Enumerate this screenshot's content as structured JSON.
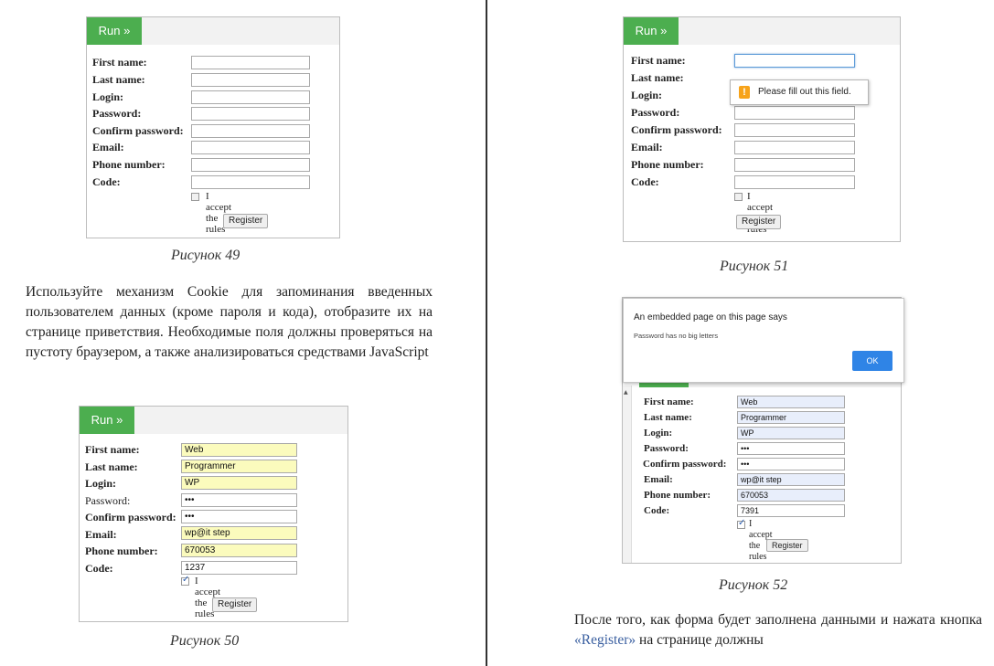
{
  "forms": {
    "run_label": "Run »",
    "labels": [
      "First name:",
      "Last name:",
      "Login:",
      "Password:",
      "Confirm password:",
      "Email:",
      "Phone number:",
      "Code:"
    ],
    "accept_label": "I accept the rules",
    "register_label": "Register",
    "fig50_values": [
      "Web",
      "Programmer",
      "WP",
      "•••",
      "•••",
      "wp@it step",
      "670053",
      "1237"
    ],
    "fig52_values": [
      "Web",
      "Programmer",
      "WP",
      "•••",
      "•••",
      "wp@it step",
      "670053",
      "7391"
    ]
  },
  "captions": {
    "fig49": "Рисунок 49",
    "fig50": "Рисунок 50",
    "fig51": "Рисунок 51",
    "fig52": "Рисунок 52"
  },
  "paragraph_left": "Используйте механизм Cookie для запоминания введенных пользователем данных (кроме пароля и кода), отобразите их на странице приветствия. Необходимые поля должны проверяться на пустоту браузером, а также анализироваться средствами JavaScript",
  "paragraph_right": {
    "before": "После того, как форма будет заполнена данными и нажата кнопка ",
    "highlight": "«Register»",
    "after": " на странице должны"
  },
  "validation_tooltip": "Please fill out this field.",
  "alert": {
    "title": "An embedded page on this page says",
    "message": "Password has no big letters",
    "ok_label": "OK"
  },
  "colors": {
    "run_button": "#4cae4f",
    "autofill": "#fbfbbd",
    "ok_button": "#2f84e6",
    "link_text": "#3a5fa0"
  },
  "icons": {
    "warning": "warning-icon",
    "checkbox": "checkbox-icon"
  }
}
